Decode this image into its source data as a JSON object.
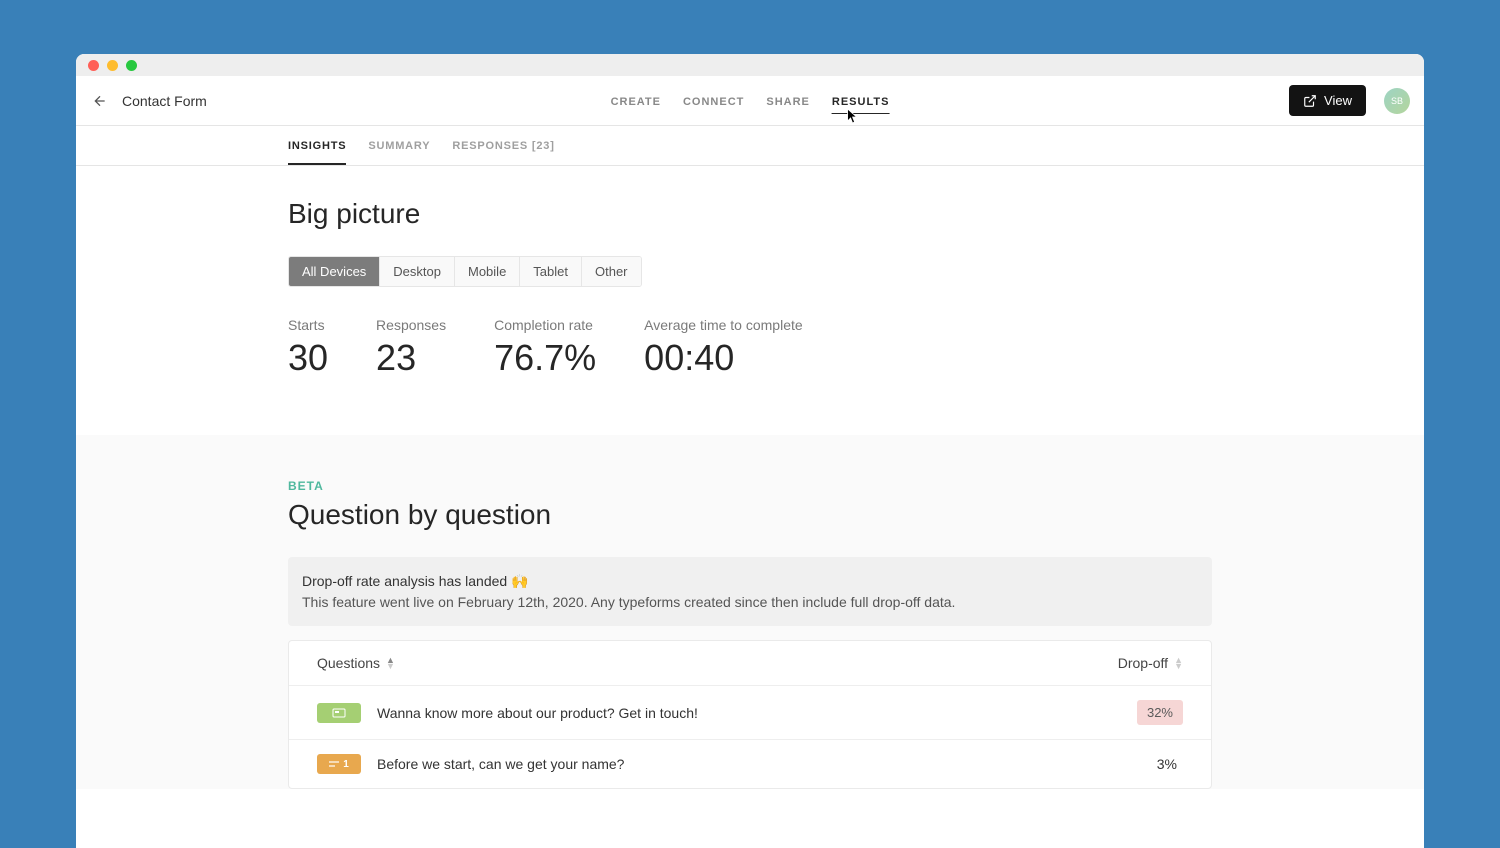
{
  "header": {
    "form_title": "Contact Form",
    "nav": [
      "CREATE",
      "CONNECT",
      "SHARE",
      "RESULTS"
    ],
    "nav_active": 3,
    "view_label": "View",
    "avatar_initials": "SB"
  },
  "sub_tabs": {
    "items": [
      "INSIGHTS",
      "SUMMARY",
      "RESPONSES [23]"
    ],
    "active": 0
  },
  "big_picture": {
    "title": "Big picture",
    "devices": [
      "All Devices",
      "Desktop",
      "Mobile",
      "Tablet",
      "Other"
    ],
    "device_active": 0,
    "stats": [
      {
        "label": "Starts",
        "value": "30"
      },
      {
        "label": "Responses",
        "value": "23"
      },
      {
        "label": "Completion rate",
        "value": "76.7%"
      },
      {
        "label": "Average time to complete",
        "value": "00:40"
      }
    ]
  },
  "qbq": {
    "beta": "BETA",
    "title": "Question by question",
    "notice_title": "Drop-off rate analysis has landed 🙌",
    "notice_body": "This feature went live on February 12th, 2020. Any typeforms created since then include full drop-off data.",
    "col_questions": "Questions",
    "col_dropoff": "Drop-off",
    "rows": [
      {
        "tile_class": "tile-green",
        "tile_label": "",
        "text": "Wanna know more about our product? Get in touch!",
        "dropoff": "32%",
        "highlight": true
      },
      {
        "tile_class": "tile-orange",
        "tile_label": "1",
        "text": "Before we start, can we get your name?",
        "dropoff": "3%",
        "highlight": false
      }
    ]
  }
}
